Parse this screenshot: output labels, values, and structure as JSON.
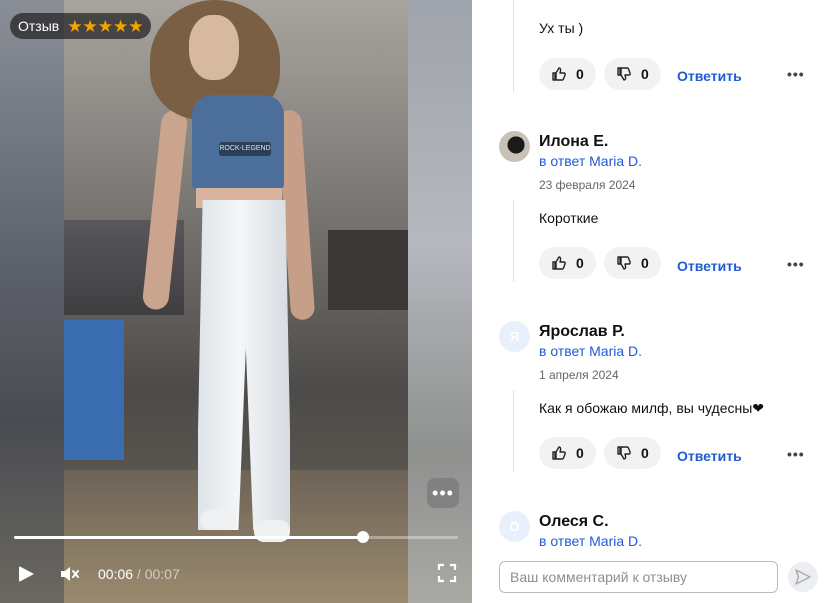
{
  "video": {
    "review_badge": "Отзыв",
    "rating_stars": 5,
    "time_current": "00:06",
    "time_separator": " / ",
    "time_total": "00:07",
    "progress_fraction": 0.785,
    "shirt_print": "ROCK-LEGEND"
  },
  "comments": [
    {
      "text": "Ух ты )",
      "likes": "0",
      "dislikes": "0",
      "reply_label": "Ответить"
    },
    {
      "author": "Илона Е.",
      "reply_to": "в ответ Maria D.",
      "date": "23 февраля 2024",
      "text": "Короткие",
      "likes": "0",
      "dislikes": "0",
      "reply_label": "Ответить"
    },
    {
      "author": "Ярослав Р.",
      "avatar_letter": "Я",
      "reply_to": "в ответ Maria D.",
      "date": "1 апреля 2024",
      "text": "Как я обожаю милф, вы чудесны❤",
      "likes": "0",
      "dislikes": "0",
      "reply_label": "Ответить"
    },
    {
      "author": "Олеся С.",
      "avatar_letter": "О",
      "reply_to": "в ответ Maria D."
    }
  ],
  "composer": {
    "placeholder": "Ваш комментарий к отзыву"
  },
  "colors": {
    "accent": "#1f5bd6",
    "star": "#f5a300"
  }
}
